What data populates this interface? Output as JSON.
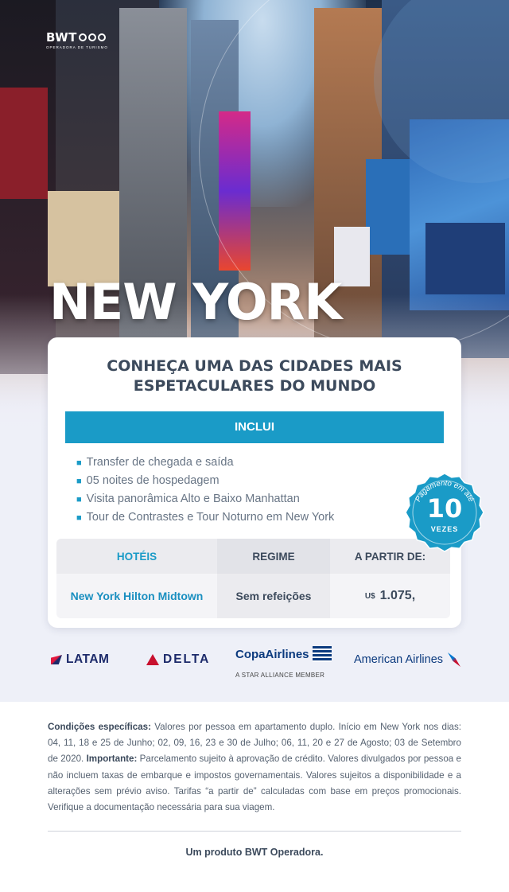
{
  "brand": {
    "logo_text": "BWT",
    "logo_sub": "OPERADORA DE TURISMO"
  },
  "hero": {
    "city": "NEW YORK"
  },
  "card": {
    "title_line1": "CONHEÇA UMA DAS CIDADES MAIS",
    "title_line2": "ESPETACULARES DO MUNDO",
    "inclui_label": "INCLUI",
    "items": [
      "Transfer de chegada e saída",
      "05 noites de hospedagem",
      "Visita panorâmica Alto e Baixo Manhattan",
      "Tour de Contrastes e Tour Noturno em New York"
    ],
    "table": {
      "headers": [
        "HOTÉIS",
        "REGIME",
        "A PARTIR DE:"
      ],
      "row": {
        "hotel": "New York Hilton Midtown",
        "regime": "Sem refeições",
        "currency": "U$",
        "price": "1.075,"
      }
    }
  },
  "badge": {
    "curve_text": "Pagamento em até",
    "number": "10",
    "unit": "VEZES"
  },
  "airlines": {
    "latam": "LATAM",
    "delta": "DELTA",
    "copa": "CopaAirlines",
    "copa_sub": "A STAR ALLIANCE MEMBER",
    "american": "American Airlines"
  },
  "footer": {
    "cond_label": "Condições específicas:",
    "cond_text": " Valores por pessoa em apartamento duplo. Início em New York nos dias: 04, 11, 18 e 25 de Junho; 02, 09, 16, 23 e 30 de Julho; 06, 11, 20 e 27 de Agosto; 03 de Setembro de 2020. ",
    "important_label": "Importante:",
    "important_text": " Parcelamento sujeito à aprovação de crédito. Valores divulgados por pessoa e não incluem taxas de embarque e impostos governamentais. Valores sujeitos a disponibilidade e a alterações sem prévio aviso. Tarifas “a partir de” calculadas com base em preços promocionais. Verifique a documentação necessária para sua viagem.",
    "product": "Um produto BWT Operadora."
  },
  "colors": {
    "accent": "#1a9bc7",
    "title": "#3c4a5c",
    "badge": "#1a9bc7"
  }
}
